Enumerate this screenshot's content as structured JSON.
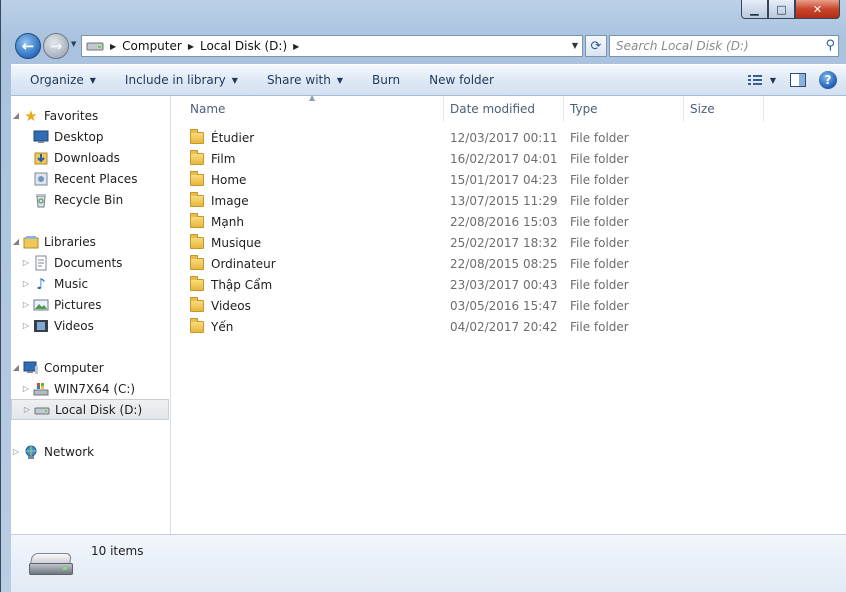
{
  "window": {
    "minimize": "▁",
    "maximize": "□",
    "close": "✕"
  },
  "nav": {
    "back": "←",
    "forward": "→"
  },
  "address": {
    "segments": [
      "Computer",
      "Local Disk (D:)"
    ]
  },
  "search": {
    "placeholder": "Search Local Disk (D:)"
  },
  "toolbar": {
    "organize": "Organize",
    "include_in_library": "Include in library",
    "share_with": "Share with",
    "burn": "Burn",
    "new_folder": "New folder"
  },
  "sidebar": {
    "favorites": {
      "label": "Favorites",
      "items": [
        "Desktop",
        "Downloads",
        "Recent Places",
        "Recycle Bin"
      ]
    },
    "libraries": {
      "label": "Libraries",
      "items": [
        "Documents",
        "Music",
        "Pictures",
        "Videos"
      ]
    },
    "computer": {
      "label": "Computer",
      "items": [
        "WIN7X64 (C:)",
        "Local Disk (D:)"
      ]
    },
    "network": {
      "label": "Network"
    }
  },
  "columns": {
    "name": "Name",
    "date_modified": "Date modified",
    "type": "Type",
    "size": "Size"
  },
  "files": [
    {
      "name": "Étudier",
      "date": "12/03/2017 00:11",
      "type": "File folder"
    },
    {
      "name": "Film",
      "date": "16/02/2017 04:01",
      "type": "File folder"
    },
    {
      "name": "Home",
      "date": "15/01/2017 04:23",
      "type": "File folder"
    },
    {
      "name": "Image",
      "date": "13/07/2015 11:29",
      "type": "File folder"
    },
    {
      "name": "Mạnh",
      "date": "22/08/2016 15:03",
      "type": "File folder"
    },
    {
      "name": "Musique",
      "date": "25/02/2017 18:32",
      "type": "File folder"
    },
    {
      "name": "Ordinateur",
      "date": "22/08/2015 08:25",
      "type": "File folder"
    },
    {
      "name": "Thập Cẩm",
      "date": "23/03/2017 00:43",
      "type": "File folder"
    },
    {
      "name": "Videos",
      "date": "03/05/2016 15:47",
      "type": "File folder"
    },
    {
      "name": "Yến",
      "date": "04/02/2017 20:42",
      "type": "File folder"
    }
  ],
  "details": {
    "count": "10 items"
  }
}
